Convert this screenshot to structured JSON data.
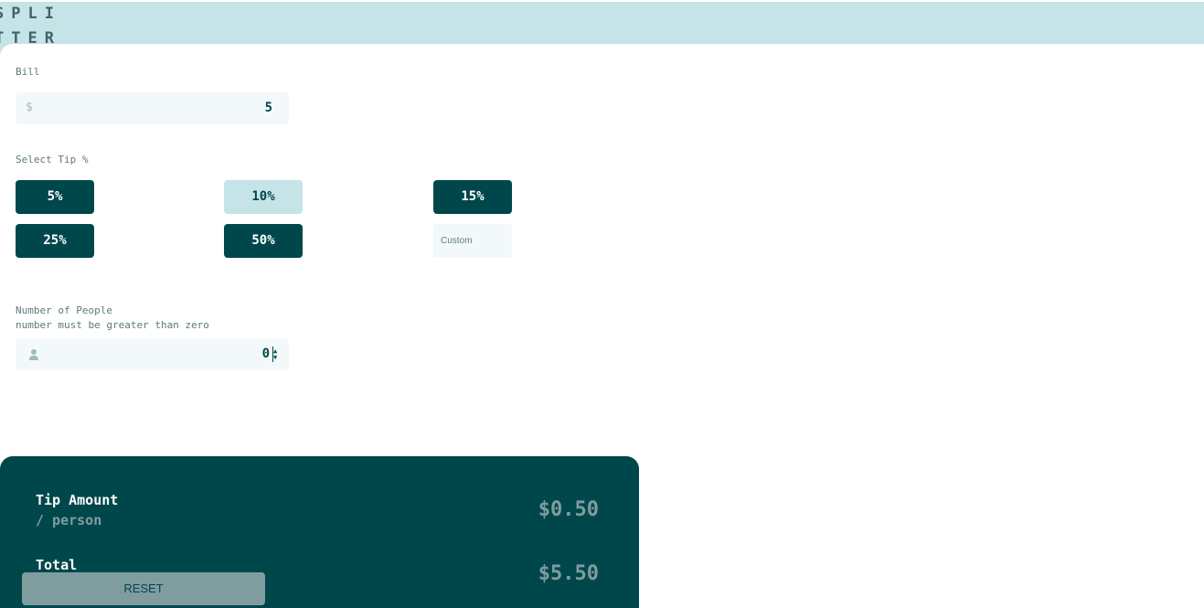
{
  "logo": {
    "line1": "SPLI",
    "line2": "TTER"
  },
  "bill": {
    "label": "Bill",
    "currency": "$",
    "value": "5"
  },
  "tip": {
    "label": "Select Tip %",
    "options": [
      "5%",
      "10%",
      "15%",
      "25%",
      "50%"
    ],
    "selected": "10%",
    "custom_placeholder": "Custom"
  },
  "people": {
    "label": "Number of People",
    "error": "number must be greater than zero",
    "value": "0"
  },
  "results": {
    "tip_label": "Tip Amount",
    "tip_sub": "/ person",
    "tip_value": "$0.50",
    "total_label": "Total",
    "total_value": "$5.50",
    "reset_label": "RESET"
  },
  "colors": {
    "primary": "#00474b",
    "accent_light": "#c5e4e7",
    "input_bg": "#f3f9fa",
    "muted": "#7f9d9f"
  }
}
